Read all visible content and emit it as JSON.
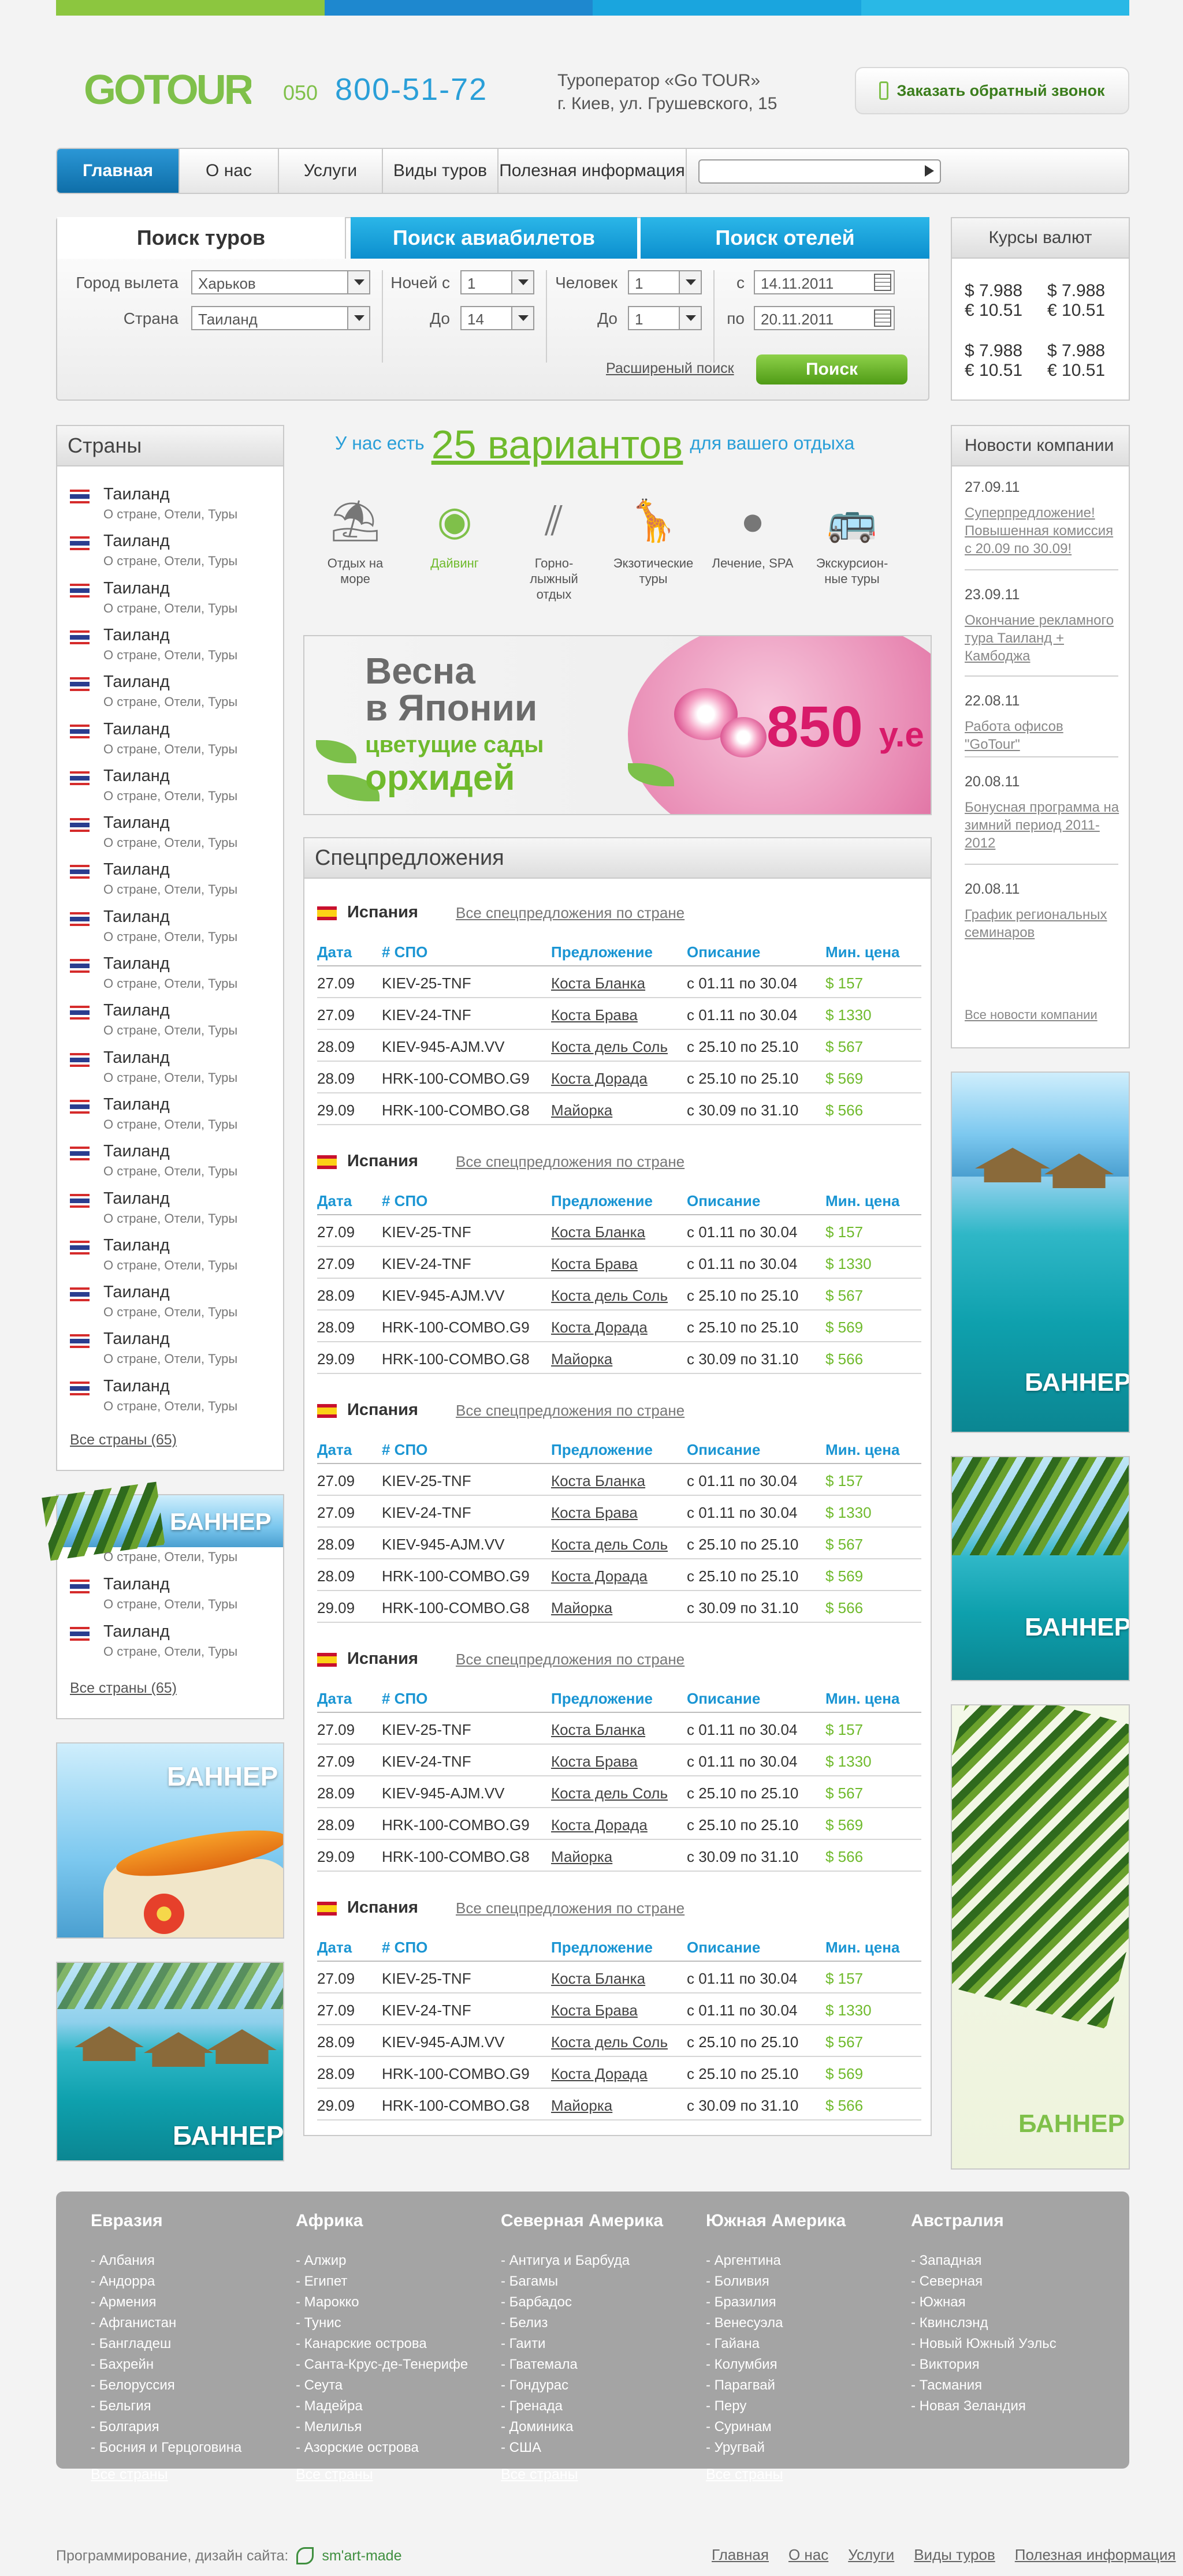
{
  "brand": {
    "logo_text": "GOTOUR",
    "colors": {
      "green": "#7fc04a",
      "blue": "#2a9fd8",
      "navActive": "#1a80c0"
    }
  },
  "header": {
    "phone_prefix": "050",
    "phone": "800-51-72",
    "operator": "Туроператор «Go TOUR»",
    "address": "г. Киев, ул. Грушевского, 15",
    "callback": "Заказать обратный звонок"
  },
  "nav": {
    "items": [
      "Главная",
      "О нас",
      "Услуги",
      "Виды туров",
      "Полезная информация"
    ],
    "search_placeholder": ""
  },
  "search": {
    "tabs": [
      "Поиск туров",
      "Поиск авиабилетов",
      "Поиск отелей"
    ],
    "city_label": "Город вылета",
    "city_value": "Харьков",
    "country_label": "Страна",
    "country_value": "Таиланд",
    "nights_label": "Ночей с",
    "nights_value": "1",
    "to_label": "До",
    "nights_to": "14",
    "people_label": "Человек",
    "people_value": "1",
    "people_to_label": "До",
    "people_to": "1",
    "from_label": "с",
    "date_from": "14.11.2011",
    "till_label": "по",
    "date_to": "20.11.2011",
    "ext_link": "Расширеный поиск",
    "button": "Поиск"
  },
  "rates": {
    "title": "Курсы валют",
    "rows": [
      [
        "$ 7.988",
        "$ 7.988"
      ],
      [
        "€ 10.51",
        "€ 10.51"
      ],
      [
        "$ 7.988",
        "$ 7.988"
      ],
      [
        "€ 10.51",
        "€ 10.51"
      ]
    ]
  },
  "countries": {
    "title": "Страны",
    "name": "Таиланд",
    "sub": "О стране, Отели, Туры",
    "all": "Все страны (65)"
  },
  "tagline": {
    "pre": "У нас есть",
    "num": "25 вариантов",
    "post": "для вашего отдыха"
  },
  "tours": [
    {
      "label": "Отдых на море",
      "icon": "beach-chair-icon"
    },
    {
      "label": "Дайвинг",
      "icon": "diving-mask-icon"
    },
    {
      "label": "Горно-лыжный отдых",
      "icon": "ski-icon"
    },
    {
      "label": "Экзотические туры",
      "icon": "giraffe-icon"
    },
    {
      "label": "Лечение, SPA",
      "icon": "spa-stones-icon"
    },
    {
      "label": "Экскурсион-ные туры",
      "icon": "bus-icon"
    }
  ],
  "promo": {
    "line1": "Весна",
    "line2": "в Японии",
    "line3": "цветущие сады",
    "line4": "орхидей",
    "price": "850",
    "unit": "у.е"
  },
  "special": {
    "title": "Спецпредложения",
    "country": "Испания",
    "all": "Все спецпредложения по стране",
    "headers": [
      "Дата",
      "# СПО",
      "Предложение",
      "Описание",
      "Мин. цена"
    ],
    "rows": [
      [
        "27.09",
        "KIEV-25-TNF",
        "Коста Бланка",
        "с 01.11 по 30.04",
        "$ 157"
      ],
      [
        "27.09",
        "KIEV-24-TNF",
        "Коста Брава",
        "с 01.11 по 30.04",
        "$ 1330"
      ],
      [
        "28.09",
        "KIEV-945-AJM.VV",
        "Коста дель Соль",
        "с 25.10 по 25.10",
        "$ 567"
      ],
      [
        "28.09",
        "HRK-100-COMBO.G9",
        "Коста Дорада",
        "с 25.10 по 25.10",
        "$ 569"
      ],
      [
        "29.09",
        "HRK-100-COMBO.G8",
        "Майорка",
        "с 30.09 по 31.10",
        "$ 566"
      ]
    ]
  },
  "news": {
    "title": "Новости компании",
    "items": [
      {
        "date": "27.09.11",
        "text": "Суперпредложение! Повышенная комиссия с 20.09 по 30.09!"
      },
      {
        "date": "23.09.11",
        "text": "Окончание рекламного тура Таиланд + Камбоджа"
      },
      {
        "date": "22.08.11",
        "text": "Работа офисов \"GoTour\""
      },
      {
        "date": "20.08.11",
        "text": "Бонусная программа на зимний период 2011-2012"
      },
      {
        "date": "20.08.11",
        "text": "График региональных семинаров"
      }
    ],
    "all": "Все новости компании"
  },
  "banner_label": "БАННЕР",
  "footer": {
    "cols": [
      {
        "title": "Евразия",
        "items": [
          "- Албания",
          "- Андорра",
          "- Армения",
          "- Афганистан",
          "- Бангладеш",
          "- Бахрейн",
          "- Белоруссия",
          "- Бельгия",
          "- Болгария",
          "- Босния и Герцоговина"
        ],
        "all": "Все страны"
      },
      {
        "title": "Африка",
        "items": [
          "- Алжир",
          "- Египет",
          "- Марокко",
          "- Тунис",
          "- Канарские острова",
          "- Санта-Крус-де-Тенерифе",
          "- Сеута",
          "- Мадейра",
          "- Мелилья",
          "- Азорские острова"
        ],
        "all": "Все страны"
      },
      {
        "title": "Северная Америка",
        "items": [
          "- Антигуа и Барбуда",
          "- Багамы",
          "- Барбадос",
          "- Белиз",
          "- Гаити",
          "- Гватемала",
          "- Гондурас",
          "- Гренада",
          "- Доминика",
          "- США"
        ],
        "all": "Все страны"
      },
      {
        "title": "Южная Америка",
        "items": [
          "- Аргентина",
          "- Боливия",
          "- Бразилия",
          "- Венесуэла",
          "- Гайана",
          "- Колумбия",
          "- Парагвай",
          "- Перу",
          "- Суринам",
          "- Уругвай"
        ],
        "all": "Все страны"
      },
      {
        "title": "Австралия",
        "items": [
          "- Западная",
          "- Северная",
          "- Южная",
          "- Квинслэнд",
          "- Новый Южный Уэльс",
          "- Виктория",
          "- Тасмания",
          "- Новая Зеландия"
        ],
        "all": ""
      }
    ]
  },
  "credit": {
    "text": "Программирование, дизайн сайта:",
    "maker": "sm'art-made"
  },
  "bottom_nav": [
    "Главная",
    "О нас",
    "Услуги",
    "Виды туров",
    "Полезная информация"
  ]
}
